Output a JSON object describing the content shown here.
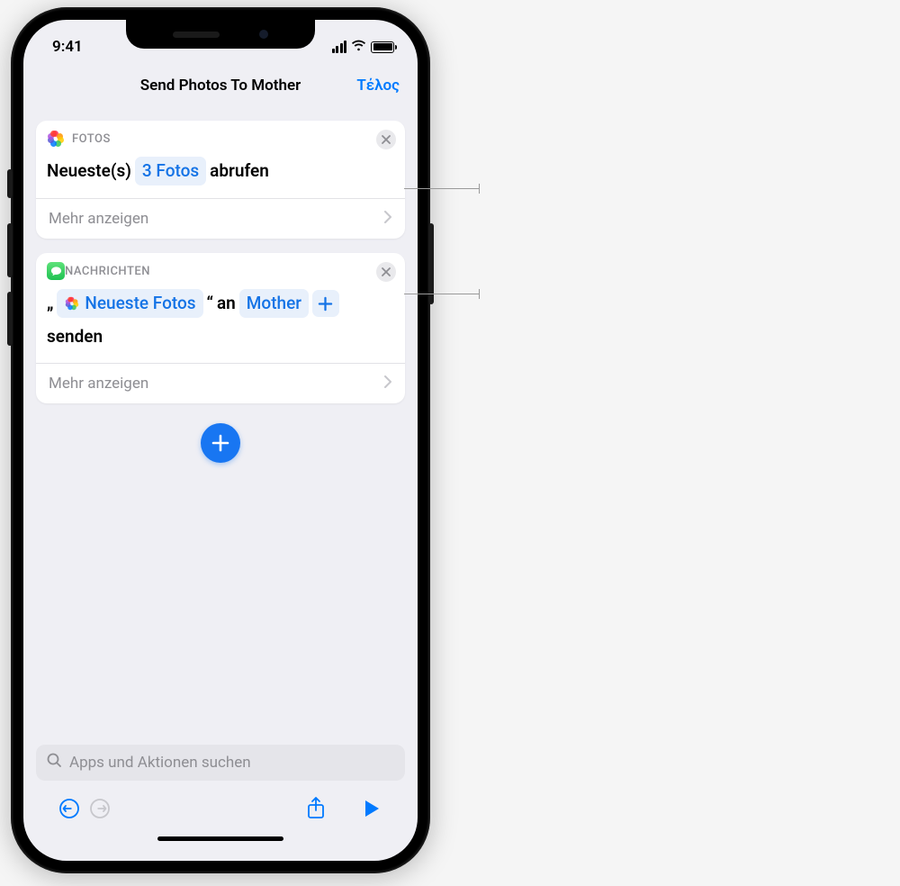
{
  "status_bar": {
    "time": "9:41"
  },
  "nav": {
    "title": "Send Photos To Mother",
    "done": "Τέλος"
  },
  "actions": [
    {
      "app_label": "FOTOS",
      "text_prefix": "Neueste(s)",
      "count_token": "3 Fotos",
      "text_suffix": "abrufen",
      "show_more": "Mehr anzeigen"
    },
    {
      "app_label": "NACHRICHTEN",
      "quote_open": "„",
      "var_token": "Neueste Fotos",
      "quote_close": "“",
      "word_an": "an",
      "recipient": "Mother",
      "word_senden": "senden",
      "show_more": "Mehr anzeigen"
    }
  ],
  "search": {
    "placeholder": "Apps und Aktionen suchen"
  }
}
